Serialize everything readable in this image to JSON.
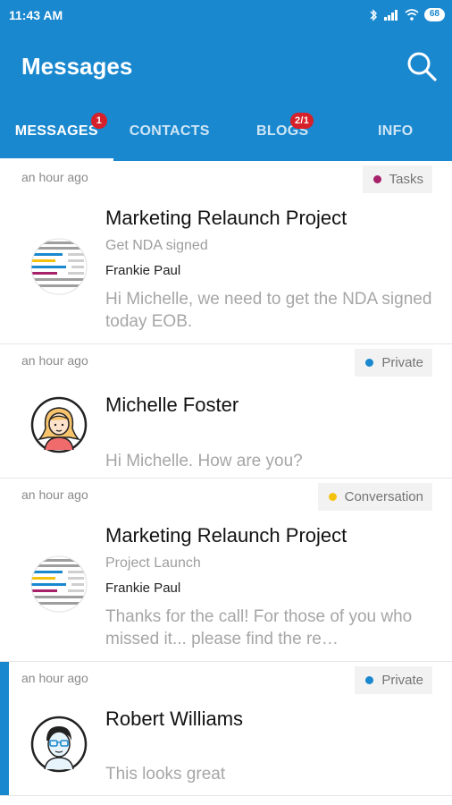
{
  "status": {
    "time": "11:43 AM",
    "battery": "68"
  },
  "appbar": {
    "title": "Messages"
  },
  "tabs": [
    {
      "label": "MESSAGES",
      "badge": "1"
    },
    {
      "label": "CONTACTS",
      "badge": ""
    },
    {
      "label": "BLOGS",
      "badge": "2/1"
    },
    {
      "label": "INFO",
      "badge": ""
    }
  ],
  "messages": [
    {
      "time": "an hour ago",
      "tag": "Tasks",
      "tag_color": "#a6206a",
      "title": "Marketing Relaunch Project",
      "subject": "Get NDA signed",
      "sender": "Frankie Paul",
      "preview": "Hi Michelle, we need to get the NDA signed today EOB.",
      "avatar": "project-icon"
    },
    {
      "time": "an hour ago",
      "tag": "Private",
      "tag_color": "#1a88cf",
      "title": "Michelle Foster",
      "subject": "",
      "sender": "",
      "preview": "Hi Michelle. How are you?",
      "avatar": "woman-avatar"
    },
    {
      "time": "an hour ago",
      "tag": "Conversation",
      "tag_color": "#f4c20d",
      "title": "Marketing Relaunch Project",
      "subject": "Project Launch",
      "sender": "Frankie Paul",
      "preview": "Thanks for the call! For those of you who missed it... please find the re…",
      "avatar": "project-icon"
    },
    {
      "time": "an hour ago",
      "tag": "Private",
      "tag_color": "#1a88cf",
      "title": "Robert Williams",
      "subject": "",
      "sender": "",
      "preview": "This looks great",
      "avatar": "man-avatar"
    }
  ]
}
